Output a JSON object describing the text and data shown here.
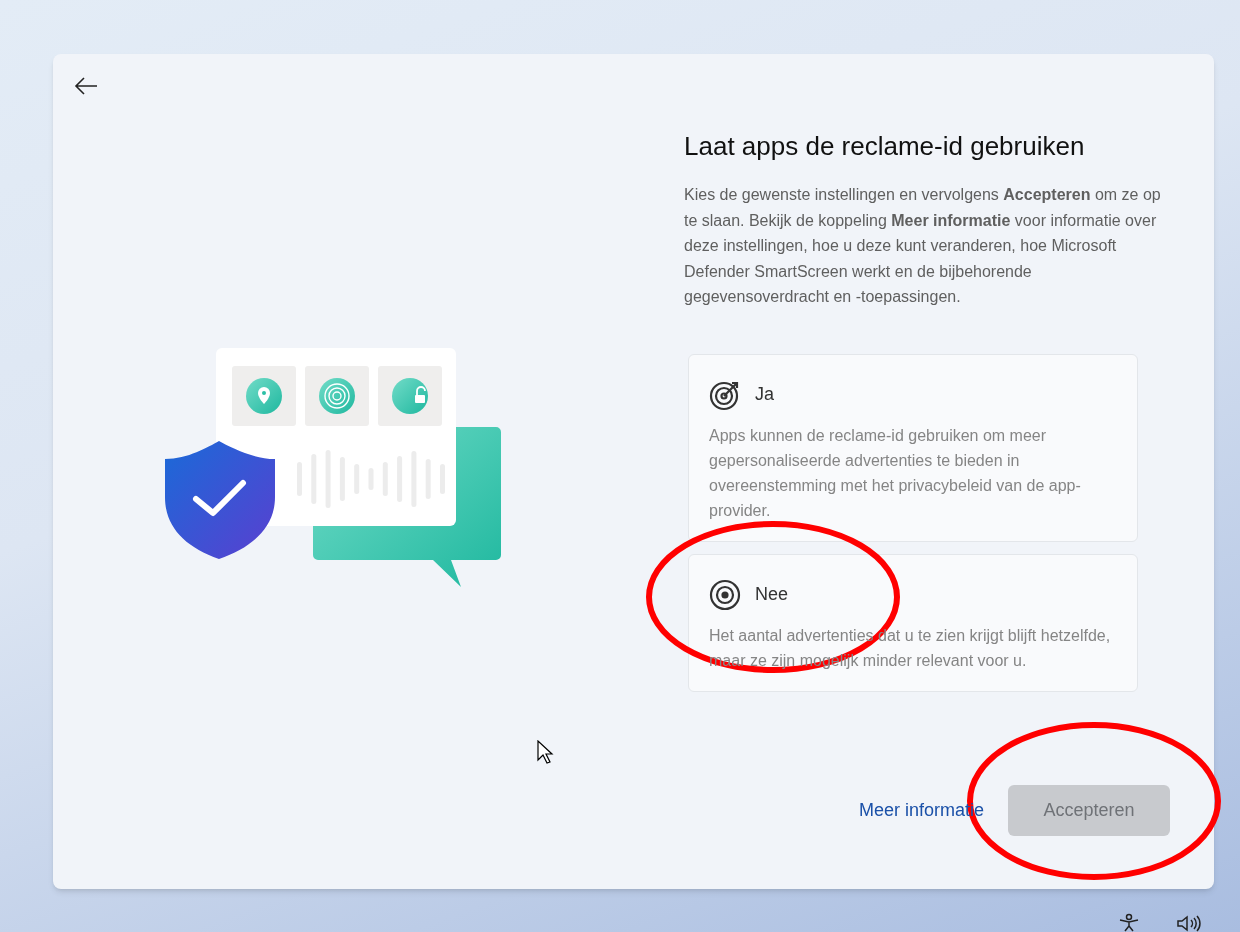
{
  "page": {
    "title": "Laat apps de reclame-id gebruiken",
    "description": "Kies de gewenste instellingen en vervolgens **Accepteren** om ze op te slaan. Bekijk de koppeling **Meer informatie** voor informatie over deze instellingen, hoe u deze kunt veranderen, hoe Microsoft Defender SmartScreen werkt en de bijbehorende gegevensoverdracht en -toepassingen."
  },
  "options": [
    {
      "kind": "target",
      "label": "Ja",
      "description": "Apps kunnen de reclame-id gebruiken om meer gepersonaliseerde advertenties te bieden in overeenstemming met het privacybeleid van de app-provider.",
      "selected": false
    },
    {
      "kind": "bullseye",
      "label": "Nee",
      "description": "Het aantal advertenties dat u te zien krijgt blijft hetzelfde, maar ze zijn mogelijk minder relevant voor u.",
      "selected": false
    }
  ],
  "footer": {
    "link": "Meer informatie",
    "button": {
      "label": "Accepteren",
      "disabled": true
    }
  },
  "annotations": [
    {
      "kind": "ellipse",
      "color": "#ff0000"
    },
    {
      "kind": "ellipse",
      "color": "#ff0000"
    }
  ]
}
